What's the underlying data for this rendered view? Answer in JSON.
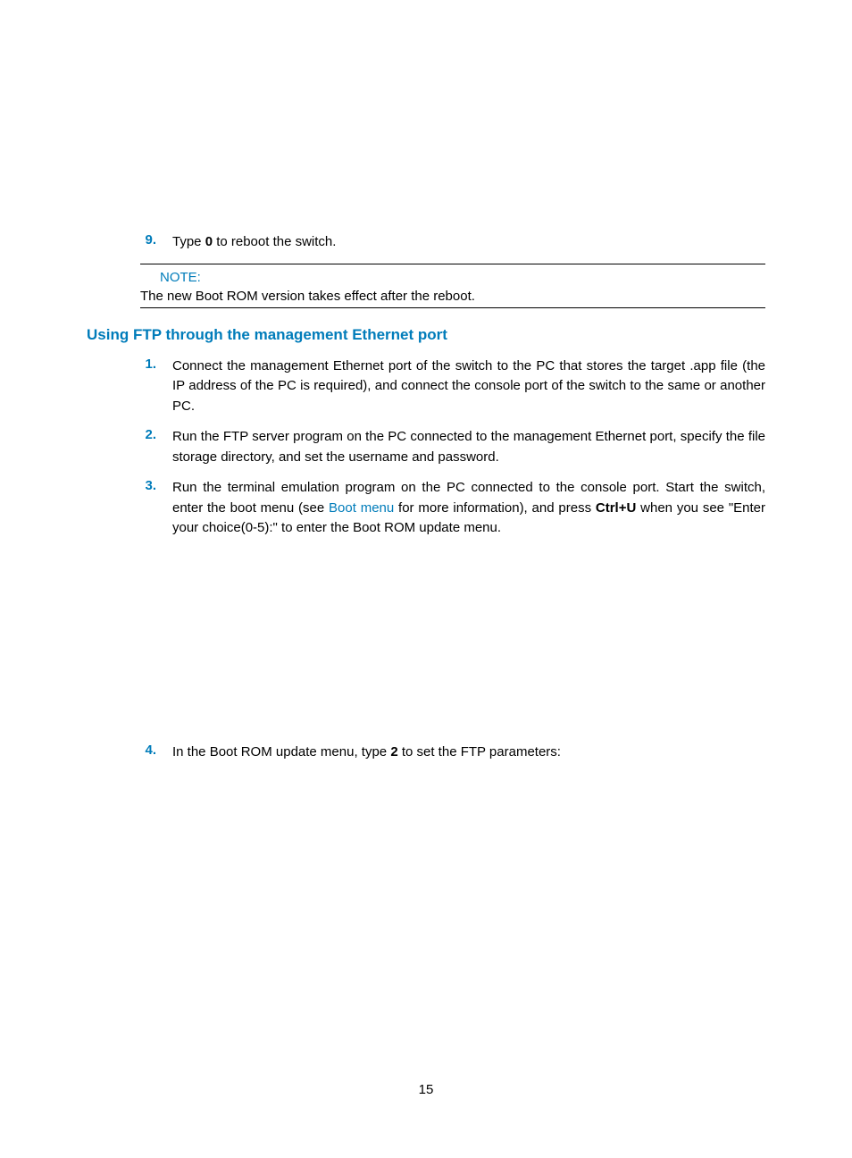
{
  "step9": {
    "num": "9.",
    "text_a": "Type ",
    "bold": "0",
    "text_b": " to reboot the switch."
  },
  "note": {
    "label": "NOTE:",
    "text": "The new Boot ROM version takes effect after the reboot."
  },
  "heading": "Using FTP through the management Ethernet port",
  "step1": {
    "num": "1.",
    "text": "Connect the management Ethernet port of the switch to the PC that stores the target .app file (the IP address of the PC is required), and connect the console port of the switch to the same or another PC."
  },
  "step2": {
    "num": "2.",
    "text": "Run the FTP server program on the PC connected to the management Ethernet port, specify the file storage directory, and set the username and password."
  },
  "step3": {
    "num": "3.",
    "text_a": "Run the terminal emulation program on the PC connected to the console port. Start the switch, enter the boot menu (see ",
    "link": "Boot menu",
    "text_b": " for more information), and press ",
    "bold": "Ctrl+U",
    "text_c": " when you see \"Enter your choice(0-5):\" to enter the Boot ROM update menu."
  },
  "step4": {
    "num": "4.",
    "text_a": "In the Boot ROM update menu, type ",
    "bold": "2",
    "text_b": " to set the FTP parameters:"
  },
  "pageNumber": "15"
}
